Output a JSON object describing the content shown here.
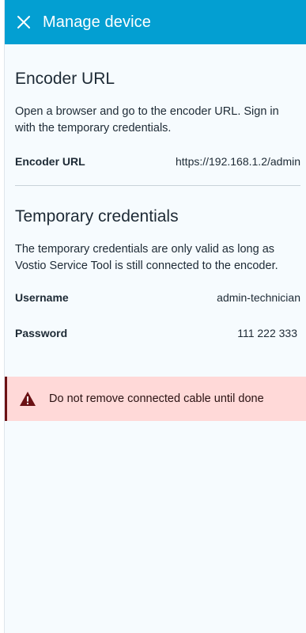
{
  "header": {
    "title": "Manage device"
  },
  "encoder": {
    "title": "Encoder URL",
    "description": "Open a browser and go to the encoder URL. Sign in with the temporary credentials.",
    "url_label": "Encoder URL",
    "url_value": "https://192.168.1.2/admin"
  },
  "credentials": {
    "title": "Temporary credentials",
    "description": "The temporary credentials are only valid as long as Vostio Service Tool is still connected to the encoder.",
    "username_label": "Username",
    "username_value": "admin-technician",
    "password_label": "Password",
    "password_value": "111 222 333"
  },
  "warning": {
    "icon": "warning-triangle-icon",
    "text": "Do not remove connected cable until done"
  },
  "colors": {
    "header": "#039fd2",
    "warning_bg": "#ffd9d8",
    "warning_accent": "#6b1114"
  }
}
